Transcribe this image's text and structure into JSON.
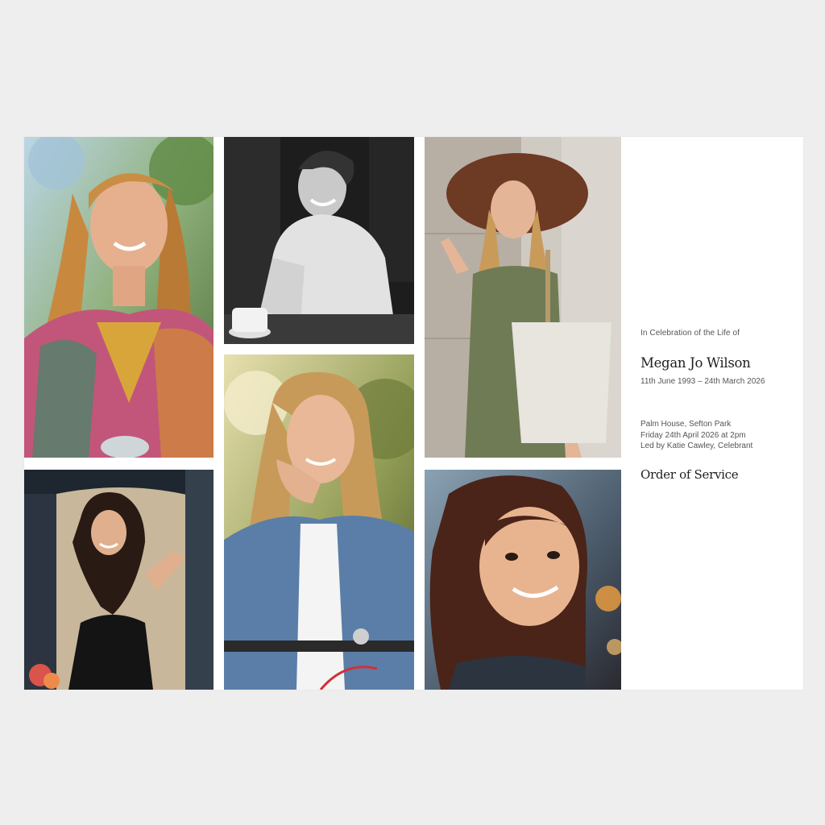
{
  "card": {
    "intro": "In Celebration of the Life of",
    "name": "Megan Jo Wilson",
    "dates": "11th June 1993 – 24th March 2026",
    "venue": "Palm House, Sefton Park",
    "datetime": "Friday 24th April 2026 at 2pm",
    "officiant": "Led by Katie Cawley, Celebrant",
    "heading": "Order of Service"
  },
  "colors": {
    "background": "#eeeeee",
    "card": "#ffffff",
    "heading_text": "#1e1e1e",
    "body_text": "#555555"
  }
}
